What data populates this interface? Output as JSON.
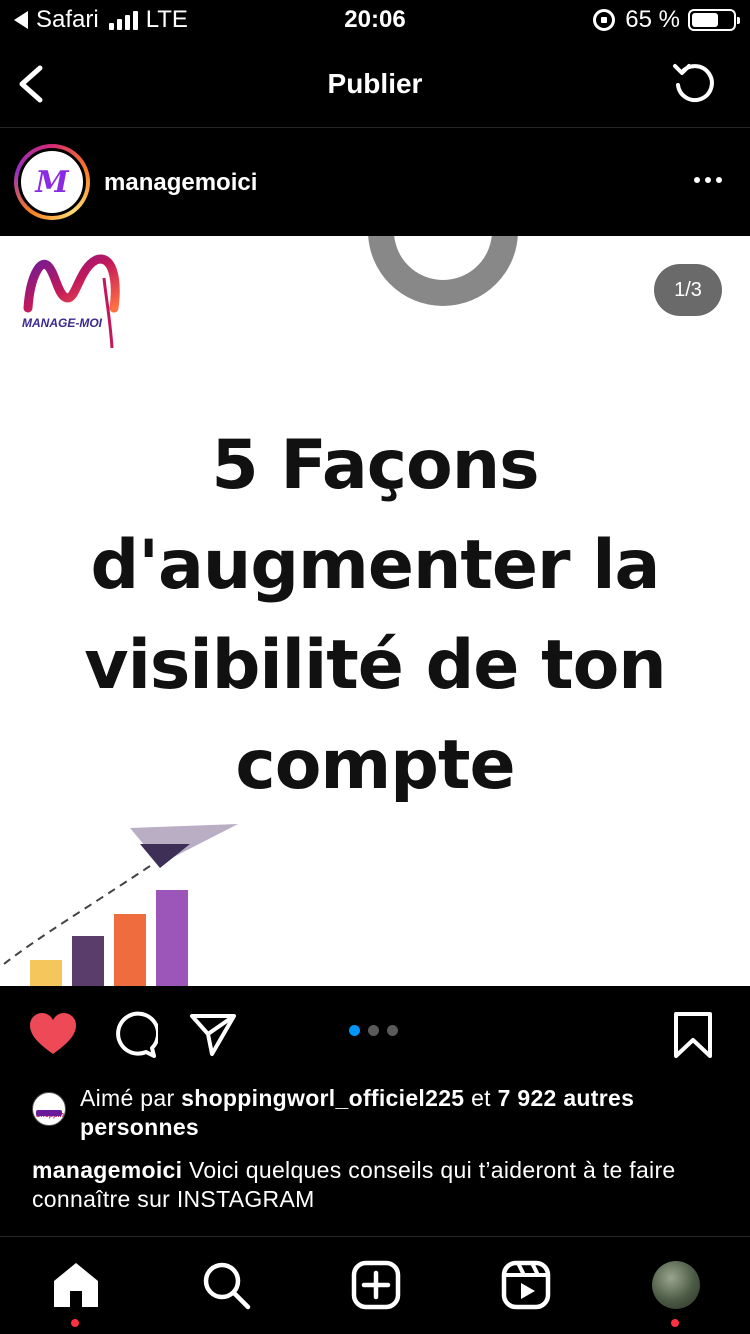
{
  "status_bar": {
    "carrier": "Safari",
    "network": "LTE",
    "time": "20:06",
    "battery": "65 %",
    "battery_level": 0.65
  },
  "header": {
    "title": "Publier",
    "back_icon": "chevron-left-icon",
    "refresh_icon": "refresh-icon"
  },
  "post": {
    "username": "managemoici",
    "avatar_letter": "M",
    "image": {
      "logo_text": "MANAGE-MOI",
      "logo_letter": "M",
      "counter": "1/3",
      "headline_lines": [
        "5 Façons",
        "d'augmenter la",
        "visibilité de ton",
        "compte"
      ]
    },
    "carousel": {
      "total": 3,
      "active": 1
    },
    "liked": true,
    "likes": {
      "prefix": "Aimé par",
      "liker_name": "shoppingworl_officiel225",
      "middle": "et",
      "others": "7 922 autres personnes",
      "liker_avatar_text": "Shopping"
    },
    "caption": {
      "username": "managemoici",
      "text": "Voici quelques conseils qui t’aideront à te faire connaître sur INSTAGRAM"
    }
  },
  "tab_bar": {
    "items": [
      "home-icon",
      "search-icon",
      "create-icon",
      "reels-icon",
      "profile-avatar"
    ]
  },
  "colors": {
    "background": "#000000",
    "like": "#ed4956",
    "active_dot": "#0095f6",
    "notification_dot": "#ff3040"
  }
}
